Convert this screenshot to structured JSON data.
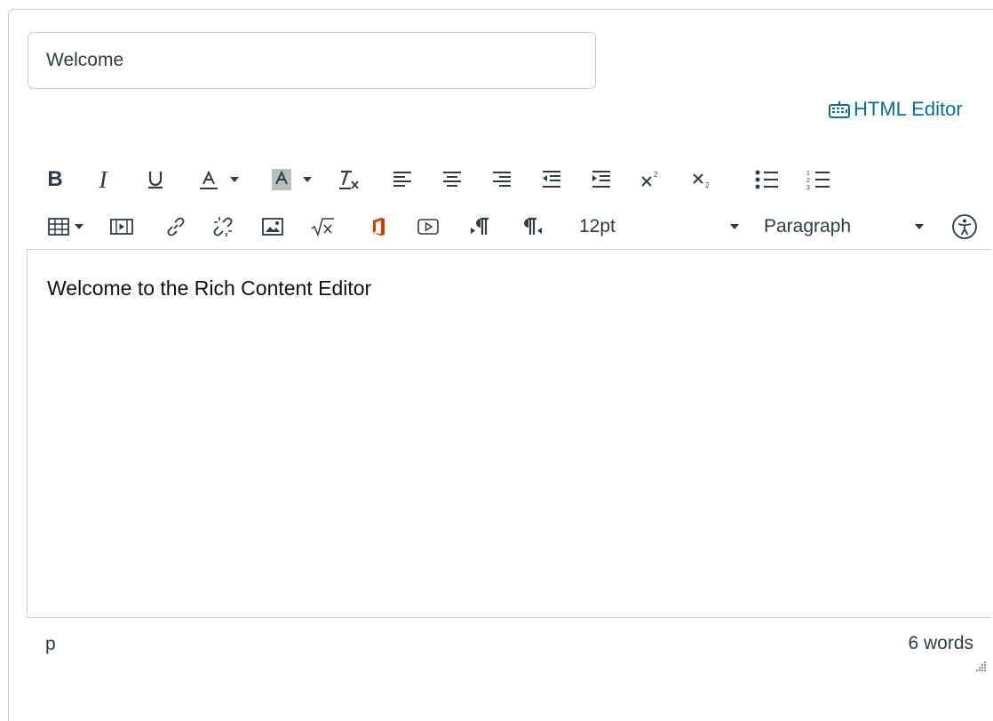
{
  "title_input": {
    "value": "Welcome"
  },
  "html_editor_link": {
    "label": "HTML Editor"
  },
  "toolbar": {
    "bold": "B",
    "italic": "I",
    "font_size": {
      "selected": "12pt"
    },
    "block_format": {
      "selected": "Paragraph"
    }
  },
  "editor": {
    "content": "Welcome to the Rich Content Editor"
  },
  "status_bar": {
    "path": "p",
    "word_count": "6 words"
  },
  "colors": {
    "link": "#0770a3",
    "text": "#2d3b45",
    "border": "#c7cdd1",
    "office_icon": "#d83b01"
  }
}
